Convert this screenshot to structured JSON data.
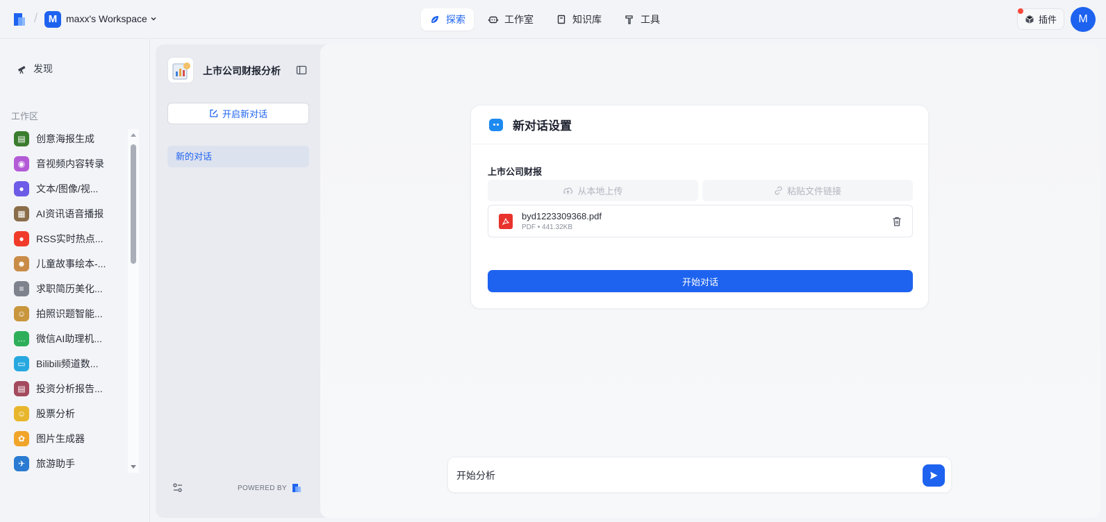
{
  "header": {
    "workspace_initial": "M",
    "workspace_name": "maxx's Workspace",
    "nav": [
      {
        "label": "探索",
        "icon": "compass-leaf-icon",
        "active": true
      },
      {
        "label": "工作室",
        "icon": "robot-icon"
      },
      {
        "label": "知识库",
        "icon": "book-icon"
      },
      {
        "label": "工具",
        "icon": "hammer-icon"
      }
    ],
    "plugin_label": "插件",
    "user_initial": "M"
  },
  "sidebar": {
    "discover_label": "发现",
    "section_label": "工作区",
    "apps": [
      {
        "label": "创意海报生成",
        "color": "#3b7d2f",
        "glyph": "▤"
      },
      {
        "label": "音视频内容转录",
        "color": "#b35ad6",
        "glyph": "◉"
      },
      {
        "label": "文本/图像/视...",
        "color": "#6c5ce7",
        "glyph": "●"
      },
      {
        "label": "AI资讯语音播报",
        "color": "#8a6d4a",
        "glyph": "▦"
      },
      {
        "label": "RSS实时热点...",
        "color": "#f03b2b",
        "glyph": "●"
      },
      {
        "label": "儿童故事绘本-...",
        "color": "#c98c48",
        "glyph": "☻"
      },
      {
        "label": "求职简历美化...",
        "color": "#7d828d",
        "glyph": "≡"
      },
      {
        "label": "拍照识题智能...",
        "color": "#c9963e",
        "glyph": "☺"
      },
      {
        "label": "微信AI助理机...",
        "color": "#2fae5a",
        "glyph": "…"
      },
      {
        "label": "Bilibili频道数...",
        "color": "#28a8e0",
        "glyph": "▭"
      },
      {
        "label": "投资分析报告...",
        "color": "#a44a5f",
        "glyph": "▤"
      },
      {
        "label": "股票分析",
        "color": "#e8b62c",
        "glyph": "☺"
      },
      {
        "label": "图片生成器",
        "color": "#f0a52a",
        "glyph": "✿"
      },
      {
        "label": "旅游助手",
        "color": "#2a7bd1",
        "glyph": "✈"
      }
    ]
  },
  "conversation_panel": {
    "bot_title": "上市公司财报分析",
    "new_chat_label": "开启新对话",
    "conversations": [
      "新的对话"
    ],
    "powered_by": "POWERED BY"
  },
  "settings_card": {
    "title": "新对话设置",
    "field_label": "上市公司财报",
    "upload_local_label": "从本地上传",
    "paste_link_label": "粘贴文件链接",
    "file": {
      "name": "byd1223309368.pdf",
      "meta": "PDF • 441.32KB"
    },
    "start_label": "开始对话"
  },
  "input": {
    "value": "开始分析"
  }
}
